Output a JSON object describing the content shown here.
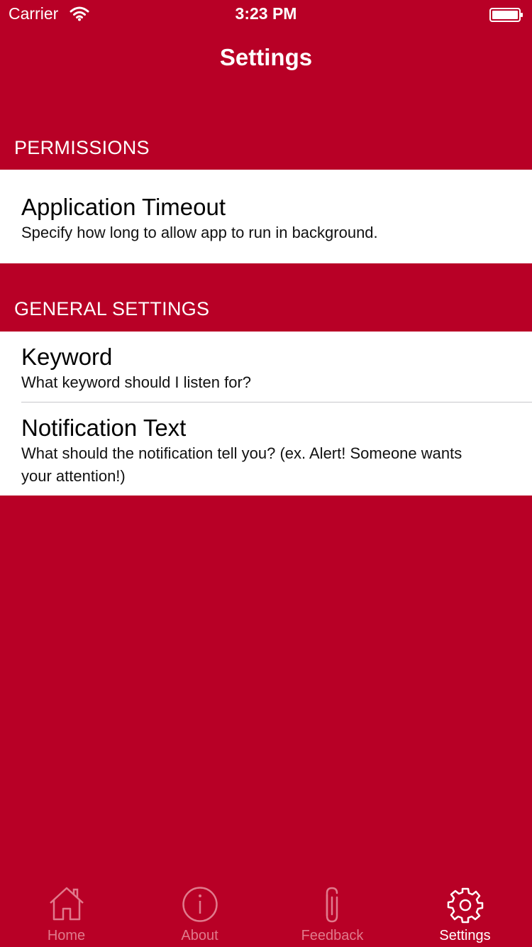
{
  "status_bar": {
    "carrier": "Carrier",
    "time": "3:23 PM",
    "wifi_icon": "wifi-icon",
    "battery_icon": "battery-icon"
  },
  "nav": {
    "title": "Settings"
  },
  "sections": {
    "permissions": {
      "header": "PERMISSIONS",
      "items": [
        {
          "title": "Application Timeout",
          "subtitle": "Specify how long to allow app to run in background."
        }
      ]
    },
    "general": {
      "header": "GENERAL SETTINGS",
      "items": [
        {
          "title": "Keyword",
          "subtitle": "What keyword should I listen for?"
        },
        {
          "title": "Notification Text",
          "subtitle": "What should the notification tell you? (ex. Alert! Someone wants your attention!)"
        }
      ]
    }
  },
  "tab_bar": {
    "tabs": [
      {
        "label": "Home",
        "icon": "home-icon",
        "active": false
      },
      {
        "label": "About",
        "icon": "info-icon",
        "active": false
      },
      {
        "label": "Feedback",
        "icon": "paperclip-icon",
        "active": false
      },
      {
        "label": "Settings",
        "icon": "gear-icon",
        "active": true
      }
    ]
  },
  "colors": {
    "background": "#b80026",
    "cell_background": "#ffffff",
    "inactive_tab": "#e07a8c",
    "active_tab": "#ffffff"
  }
}
